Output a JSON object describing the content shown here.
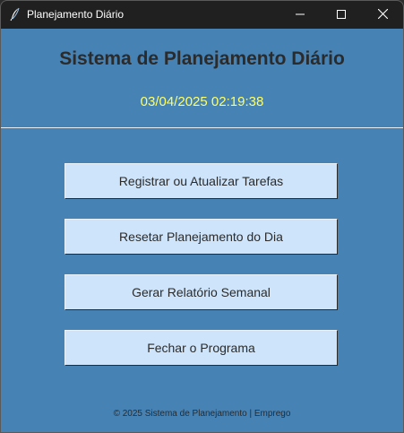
{
  "window": {
    "title": "Planejamento Diário",
    "controls": {
      "minimize_icon": "minimize-icon",
      "maximize_icon": "maximize-icon",
      "close_icon": "close-icon"
    }
  },
  "header": {
    "title": "Sistema de Planejamento Diário",
    "datetime": "03/04/2025 02:19:38"
  },
  "actions": [
    {
      "label": "Registrar ou Atualizar Tarefas"
    },
    {
      "label": "Resetar Planejamento do Dia"
    },
    {
      "label": "Gerar Relatório Semanal"
    },
    {
      "label": "Fechar o Programa"
    }
  ],
  "footer": {
    "text": "© 2025 Sistema de Planejamento | Emprego"
  },
  "colors": {
    "background": "#4682b4",
    "button": "#cde4fb",
    "clock": "#ffff66",
    "titlebar": "#202020"
  }
}
